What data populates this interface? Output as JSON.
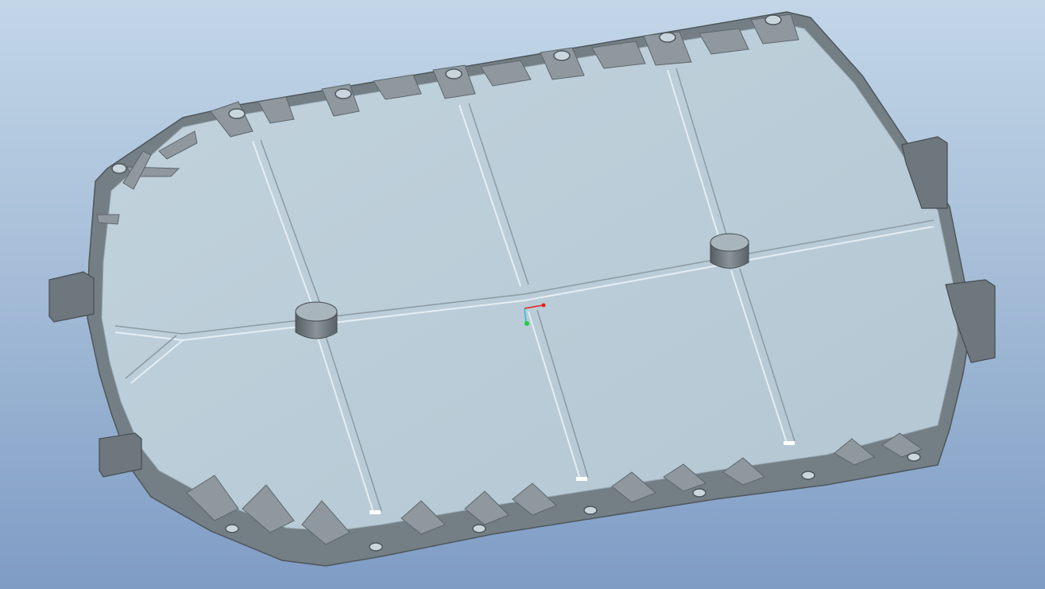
{
  "viewport": {
    "background_top": "#c3d6e8",
    "background_bottom": "#7f9cc5"
  },
  "model": {
    "part": "battery-tray-housing",
    "view": "isometric-shaded",
    "surface_color": "#b9cbd6",
    "wall_color": "#7d868d",
    "edge_color": "#5d666c"
  },
  "triad": {
    "x_axis_color": "#e02020",
    "y_axis_color": "#20d040",
    "z_axis_color": "#20c0e0"
  }
}
